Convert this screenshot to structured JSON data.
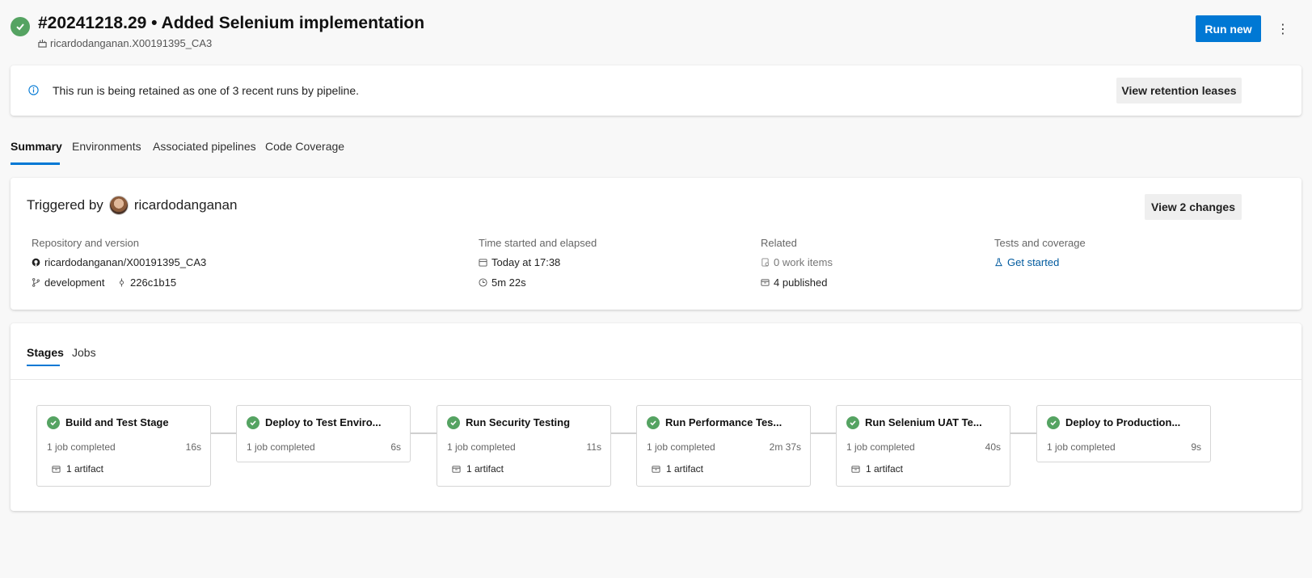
{
  "header": {
    "title": "#20241218.29 • Added Selenium implementation",
    "subtitle": "ricardodanganan.X00191395_CA3",
    "run_new_label": "Run new",
    "more_label": "⋮"
  },
  "banner": {
    "message": "This run is being retained as one of 3 recent runs by pipeline.",
    "button_label": "View retention leases"
  },
  "tabs": [
    {
      "label": "Summary"
    },
    {
      "label": "Environments"
    },
    {
      "label": "Associated pipelines"
    },
    {
      "label": "Code Coverage"
    }
  ],
  "summary": {
    "triggered_prefix": "Triggered by",
    "triggered_user": "ricardodanganan",
    "view_changes_label": "View 2 changes",
    "repo_label": "Repository and version",
    "repo_name": "ricardodanganan/X00191395_CA3",
    "branch": "development",
    "commit": "226c1b15",
    "time_label": "Time started and elapsed",
    "time_started": "Today at 17:38",
    "elapsed": "5m 22s",
    "related_label": "Related",
    "work_items": "0 work items",
    "published": "4 published",
    "tests_label": "Tests and coverage",
    "get_started": "Get started"
  },
  "stage_tabs": [
    {
      "label": "Stages"
    },
    {
      "label": "Jobs"
    }
  ],
  "stages": [
    {
      "name": "Build and Test Stage",
      "jobs": "1 job completed",
      "time": "16s",
      "artifact": "1 artifact"
    },
    {
      "name": "Deploy to Test Enviro...",
      "jobs": "1 job completed",
      "time": "6s",
      "artifact": ""
    },
    {
      "name": "Run Security Testing",
      "jobs": "1 job completed",
      "time": "11s",
      "artifact": "1 artifact"
    },
    {
      "name": "Run Performance Tes...",
      "jobs": "1 job completed",
      "time": "2m 37s",
      "artifact": "1 artifact"
    },
    {
      "name": "Run Selenium UAT Te...",
      "jobs": "1 job completed",
      "time": "40s",
      "artifact": "1 artifact"
    },
    {
      "name": "Deploy to Production...",
      "jobs": "1 job completed",
      "time": "9s",
      "artifact": ""
    }
  ],
  "colors": {
    "accent": "#0078d4",
    "success": "#55a362",
    "link": "#005a9e"
  }
}
